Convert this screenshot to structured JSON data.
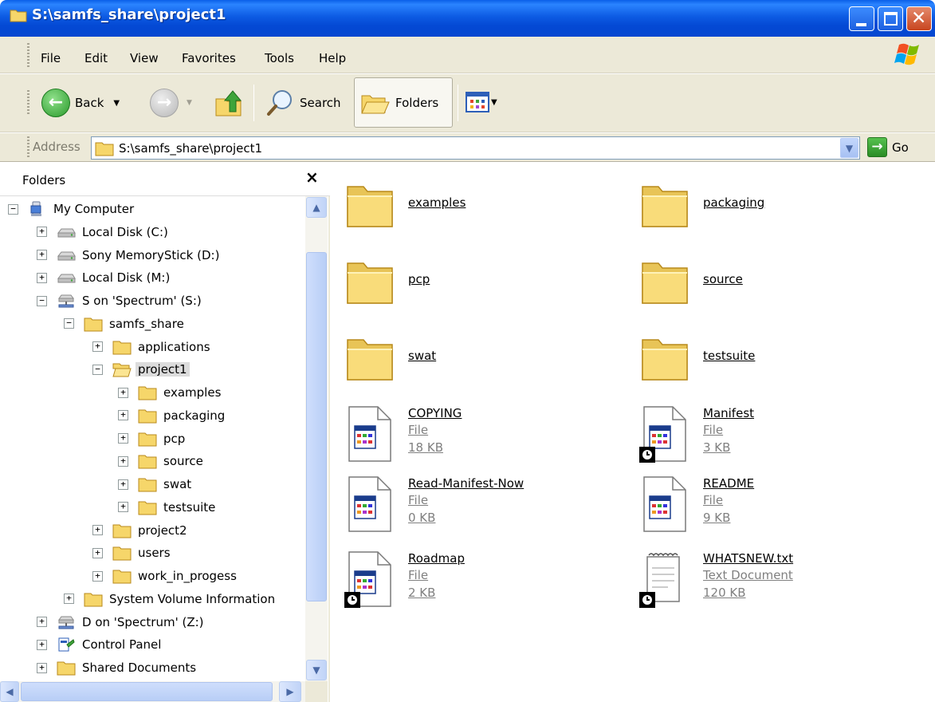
{
  "window": {
    "title": "S:\\samfs_share\\project1"
  },
  "menu": [
    "File",
    "Edit",
    "View",
    "Favorites",
    "Tools",
    "Help"
  ],
  "toolbar": {
    "back_label": "Back",
    "search_label": "Search",
    "folders_label": "Folders"
  },
  "address": {
    "label": "Address",
    "value": "S:\\samfs_share\\project1",
    "go_label": "Go"
  },
  "folders_pane": {
    "title": "Folders",
    "close": "×",
    "tree": [
      {
        "label": "My Computer",
        "expander": "−",
        "icon": "computer-icon"
      },
      {
        "label": "Local Disk (C:)",
        "expander": "+",
        "icon": "drive-icon"
      },
      {
        "label": "Sony MemoryStick (D:)",
        "expander": "+",
        "icon": "drive-icon"
      },
      {
        "label": "Local Disk (M:)",
        "expander": "+",
        "icon": "drive-icon"
      },
      {
        "label": "S on 'Spectrum' (S:)",
        "expander": "−",
        "icon": "network-drive-icon"
      },
      {
        "label": "samfs_share",
        "expander": "−",
        "icon": "folder-icon"
      },
      {
        "label": "applications",
        "expander": "+",
        "icon": "folder-icon"
      },
      {
        "label": "project1",
        "expander": "−",
        "icon": "folder-open-icon"
      },
      {
        "label": "examples",
        "expander": "+",
        "icon": "folder-icon"
      },
      {
        "label": "packaging",
        "expander": "+",
        "icon": "folder-icon"
      },
      {
        "label": "pcp",
        "expander": "+",
        "icon": "folder-icon"
      },
      {
        "label": "source",
        "expander": "+",
        "icon": "folder-icon"
      },
      {
        "label": "swat",
        "expander": "+",
        "icon": "folder-icon"
      },
      {
        "label": "testsuite",
        "expander": "+",
        "icon": "folder-icon"
      },
      {
        "label": "project2",
        "expander": "+",
        "icon": "folder-icon"
      },
      {
        "label": "users",
        "expander": "+",
        "icon": "folder-icon"
      },
      {
        "label": "work_in_progess",
        "expander": "+",
        "icon": "folder-icon"
      },
      {
        "label": "System Volume Information",
        "expander": "+",
        "icon": "folder-icon"
      },
      {
        "label": "D on 'Spectrum' (Z:)",
        "expander": "+",
        "icon": "network-drive-icon"
      },
      {
        "label": "Control Panel",
        "expander": "+",
        "icon": "control-panel-icon"
      },
      {
        "label": "Shared Documents",
        "expander": "+",
        "icon": "folder-icon"
      }
    ]
  },
  "files": [
    {
      "name": "examples",
      "kind": "folder"
    },
    {
      "name": "packaging",
      "kind": "folder"
    },
    {
      "name": "pcp",
      "kind": "folder"
    },
    {
      "name": "source",
      "kind": "folder"
    },
    {
      "name": "swat",
      "kind": "folder"
    },
    {
      "name": "testsuite",
      "kind": "folder"
    },
    {
      "name": "COPYING",
      "kind": "file",
      "type": "File",
      "size": "18 KB",
      "offline": false
    },
    {
      "name": "Manifest",
      "kind": "file",
      "type": "File",
      "size": "3 KB",
      "offline": true
    },
    {
      "name": "Read-Manifest-Now",
      "kind": "file",
      "type": "File",
      "size": "0 KB",
      "offline": false
    },
    {
      "name": "README",
      "kind": "file",
      "type": "File",
      "size": "9 KB",
      "offline": false
    },
    {
      "name": "Roadmap",
      "kind": "file",
      "type": "File",
      "size": "2 KB",
      "offline": true
    },
    {
      "name": "WHATSNEW.txt",
      "kind": "text",
      "type": "Text Document",
      "size": "120 KB",
      "offline": true
    }
  ],
  "colors": {
    "titlebar": "#0a5fe8",
    "chrome": "#ece9d8",
    "folder": "#f7d56b"
  }
}
